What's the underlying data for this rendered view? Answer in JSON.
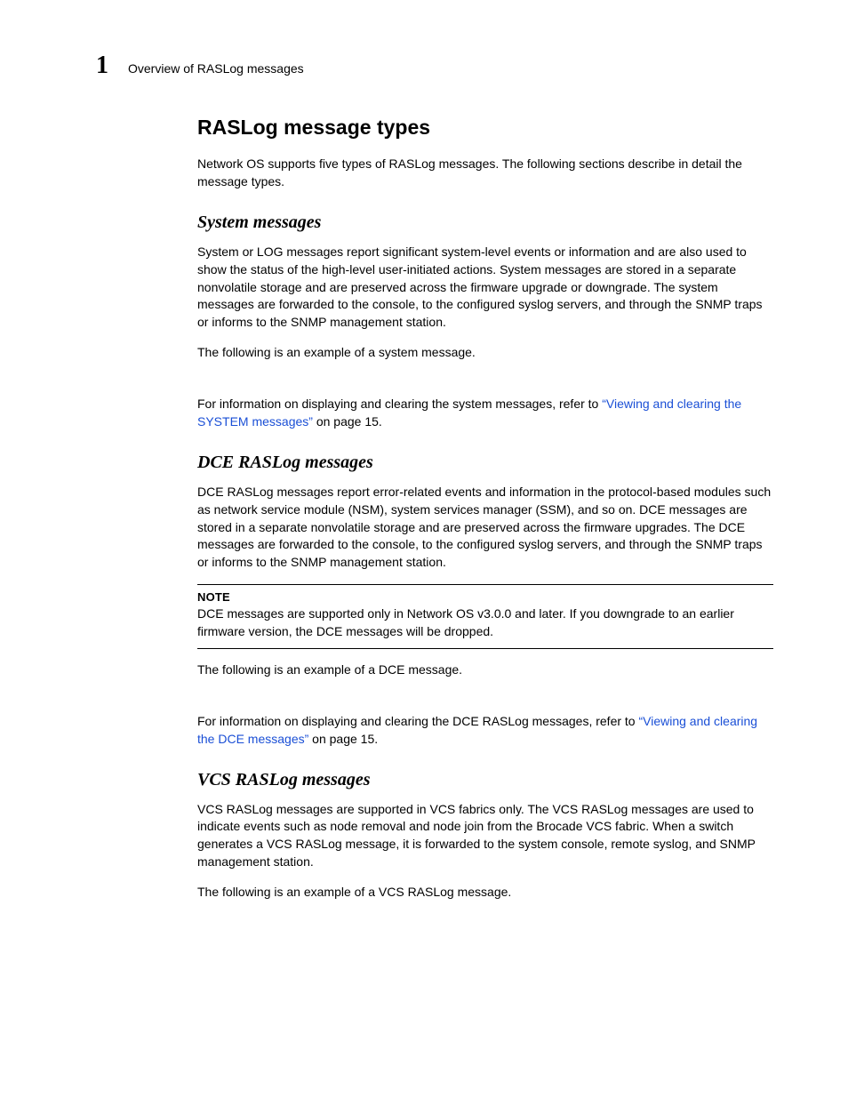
{
  "header": {
    "chapter_number": "1",
    "running_title": "Overview of RASLog messages"
  },
  "section": {
    "title": "RASLog message types",
    "intro": "Network OS supports five types of RASLog messages. The following sections describe in detail the message types."
  },
  "system": {
    "heading": "System messages",
    "p1": "System or LOG messages report significant system-level events or information and are also used to show the status of the high-level user-initiated actions. System messages are stored in a separate nonvolatile storage and are preserved across the firmware upgrade or downgrade. The system messages are forwarded to the console, to the configured syslog servers, and through the SNMP traps or informs to the SNMP management station.",
    "p2": "The following is an example of a system message.",
    "p3_pre": "For information on displaying and clearing the system messages, refer to ",
    "p3_link": "“Viewing and clearing the SYSTEM messages”",
    "p3_post": " on page 15."
  },
  "dce": {
    "heading": "DCE RASLog messages",
    "p1": "DCE RASLog messages report error-related events and information in the protocol-based modules such as network service module (NSM), system services manager (SSM), and so on. DCE messages are stored in a separate nonvolatile storage and are preserved across the firmware upgrades. The DCE messages are forwarded to the console, to the configured syslog servers, and through the SNMP traps or informs to the SNMP management station.",
    "note_label": "NOTE",
    "note_text": "DCE messages are supported only in Network OS v3.0.0 and later. If you downgrade to an earlier firmware version, the DCE messages will be dropped.",
    "p2": "The following is an example of a DCE message.",
    "p3_pre": "For information on displaying and clearing the DCE RASLog messages, refer to ",
    "p3_link": "“Viewing and clearing the DCE messages”",
    "p3_post": " on page 15."
  },
  "vcs": {
    "heading": "VCS RASLog messages",
    "p1": "VCS RASLog messages are supported in VCS fabrics only. The VCS RASLog messages are used to indicate events such as node removal and node join from the Brocade VCS fabric. When a switch generates a VCS RASLog message, it is forwarded to the system console, remote syslog, and SNMP management station.",
    "p2": "The following is an example of a VCS RASLog message."
  }
}
